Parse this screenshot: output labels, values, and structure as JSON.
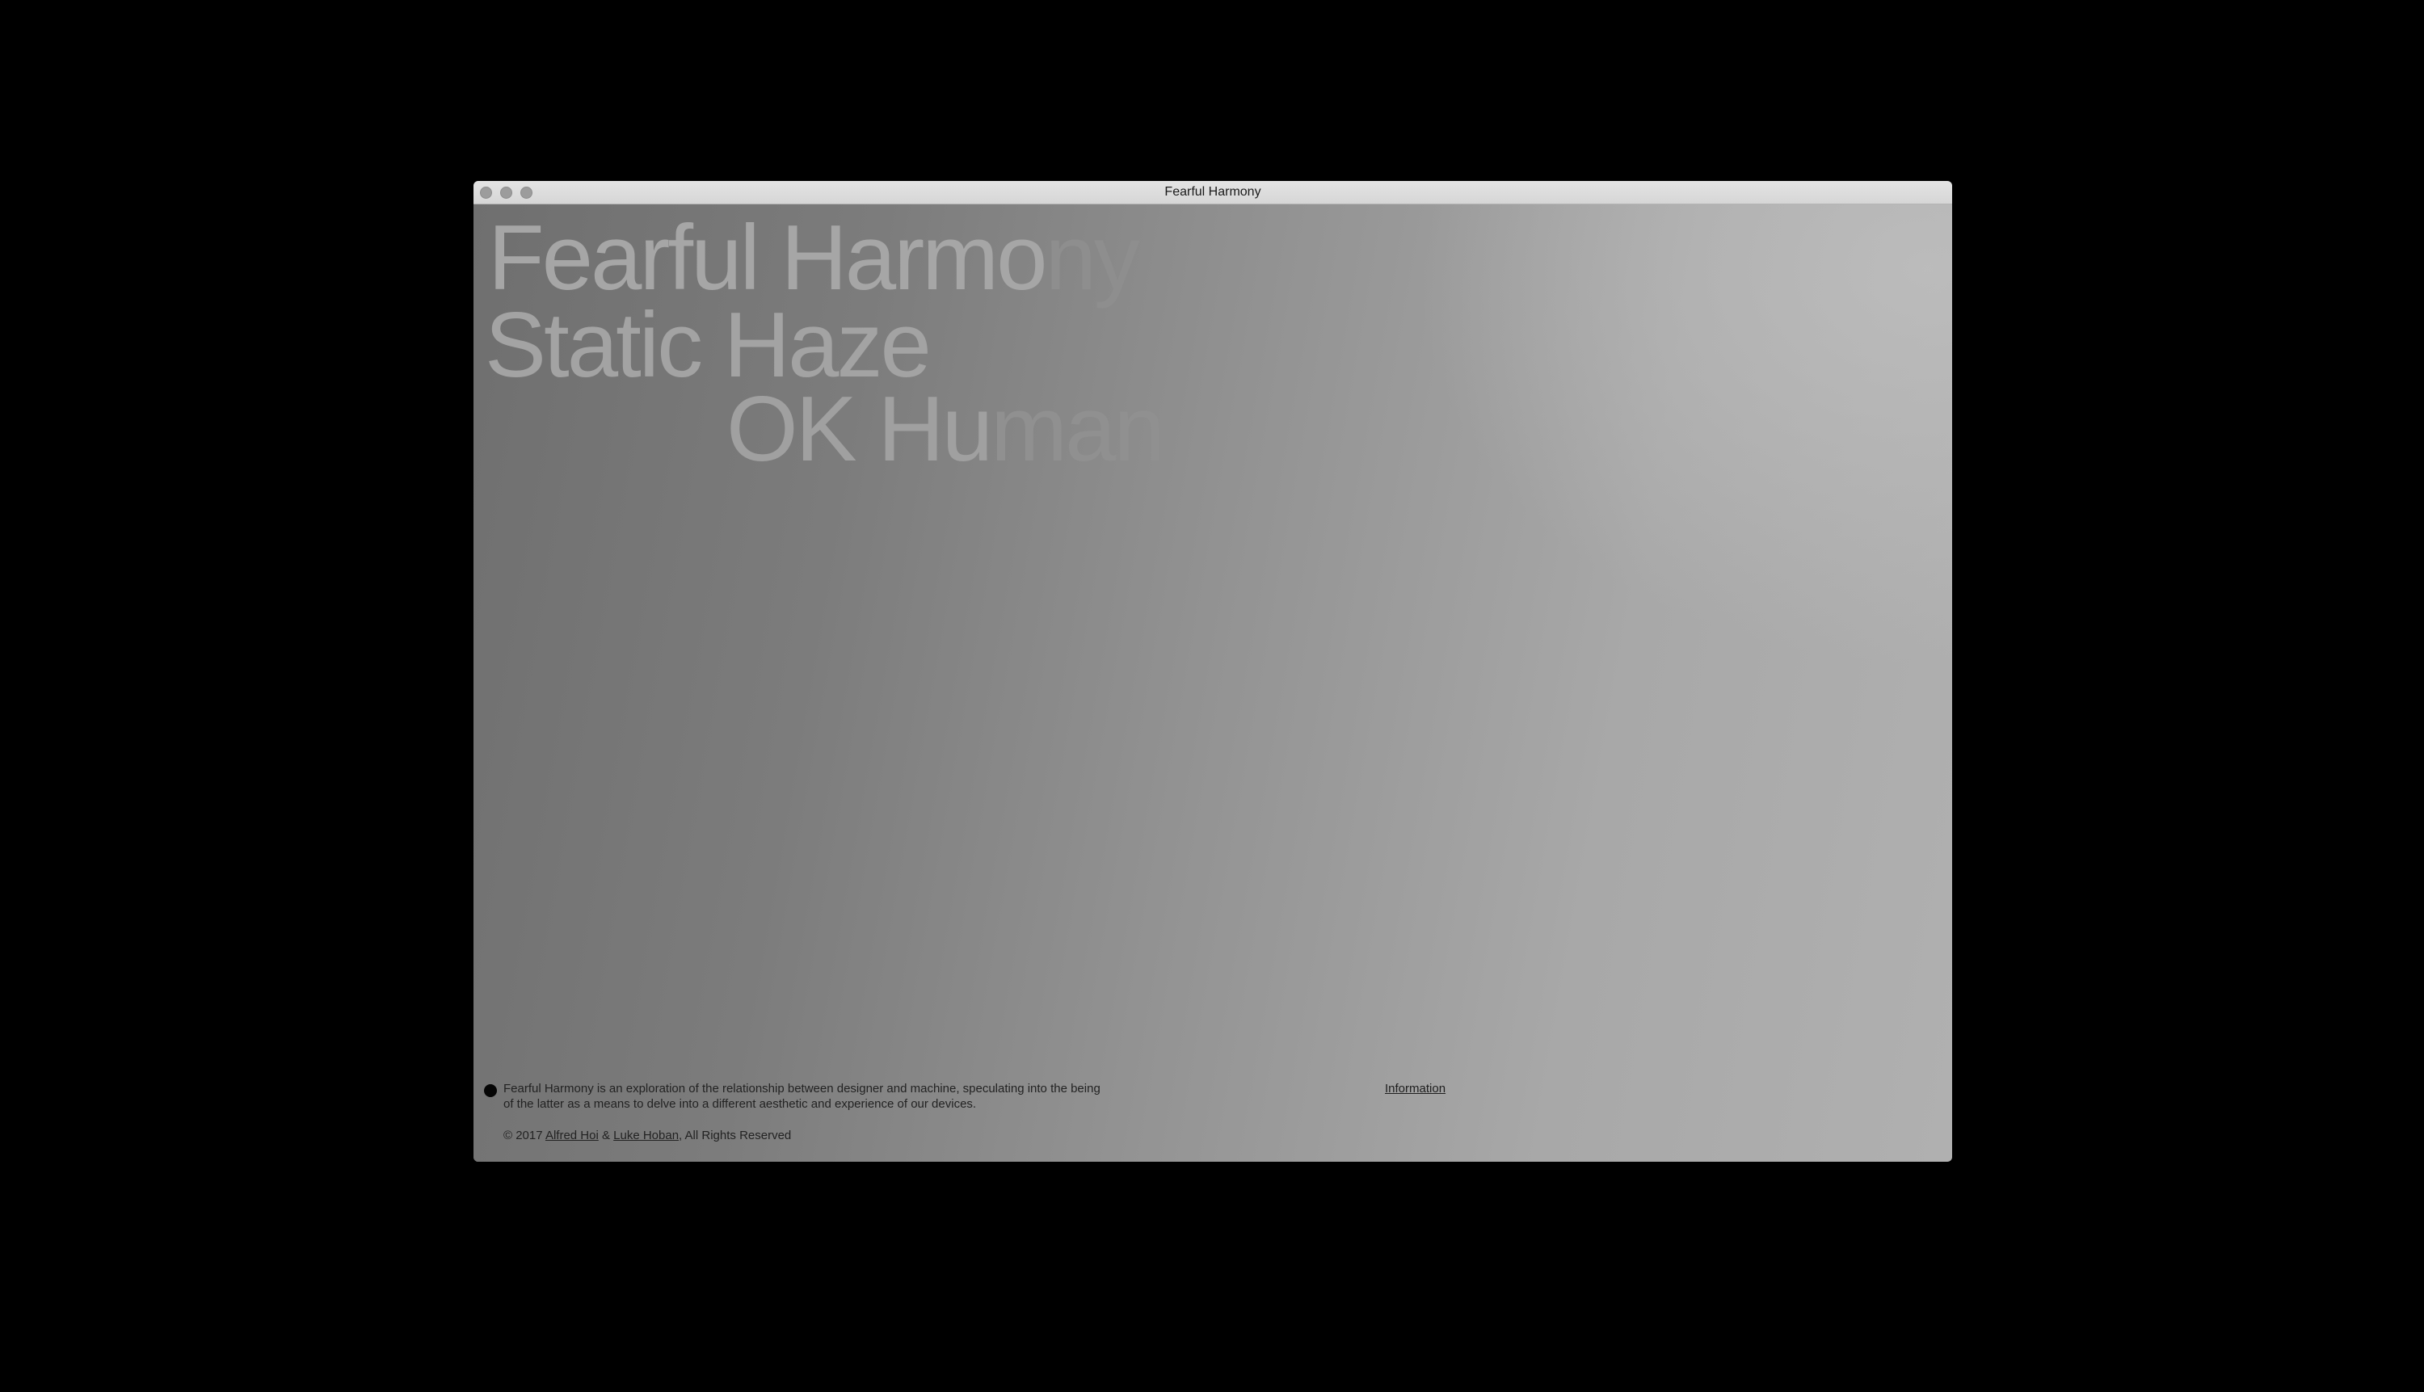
{
  "window": {
    "title": "Fearful Harmony"
  },
  "headlines": {
    "line1_main": "Fearful Harmo",
    "line1_fade": "ny",
    "line2": "Static Haze",
    "line3_main": "OK Hu",
    "line3_fade": "man"
  },
  "footer": {
    "description_line1": "Fearful Harmony is an exploration of the relationship between designer and machine, speculating into the being",
    "description_line2": "of the latter as a means to delve into a different aesthetic and experience of our devices.",
    "information_link": "Information",
    "copyright_prefix": "© 2017 ",
    "author1": "Alfred Hoi",
    "separator": " & ",
    "author2": "Luke Hoban",
    "copyright_suffix": ", All Rights Reserved"
  },
  "colors": {
    "outer_background": "#000000",
    "titlebar": "#dedede",
    "content_dark": "#6f6f6f",
    "content_light": "#b0b0b0",
    "headline_text": "#a4a4a4",
    "bullet_dot": "#050505"
  }
}
